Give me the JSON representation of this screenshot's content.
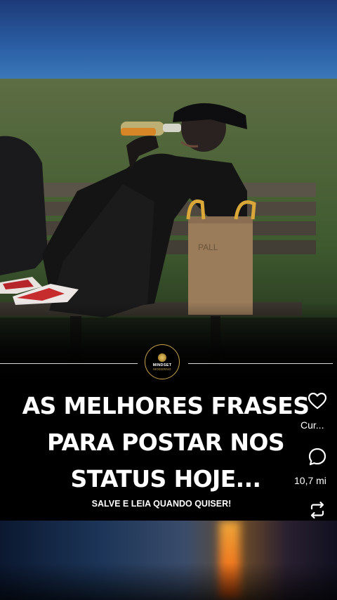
{
  "post": {
    "headline_lines": [
      "AS MELHORES FRASES",
      "PARA POSTAR NOS",
      "STATUS HOJE..."
    ],
    "subtitle": "SALVE E LEIA QUANDO QUISER!",
    "logo": {
      "line1": "MINDSET",
      "line2": "MODERNO"
    }
  },
  "actions": {
    "like": {
      "icon": "heart-icon",
      "label": "Cur..."
    },
    "comment": {
      "icon": "comment-icon",
      "label": "10,7 mi"
    },
    "repost": {
      "icon": "repost-icon"
    }
  },
  "colors": {
    "accent_gold": "#c8a24a",
    "text": "#ffffff",
    "background": "#000000"
  }
}
